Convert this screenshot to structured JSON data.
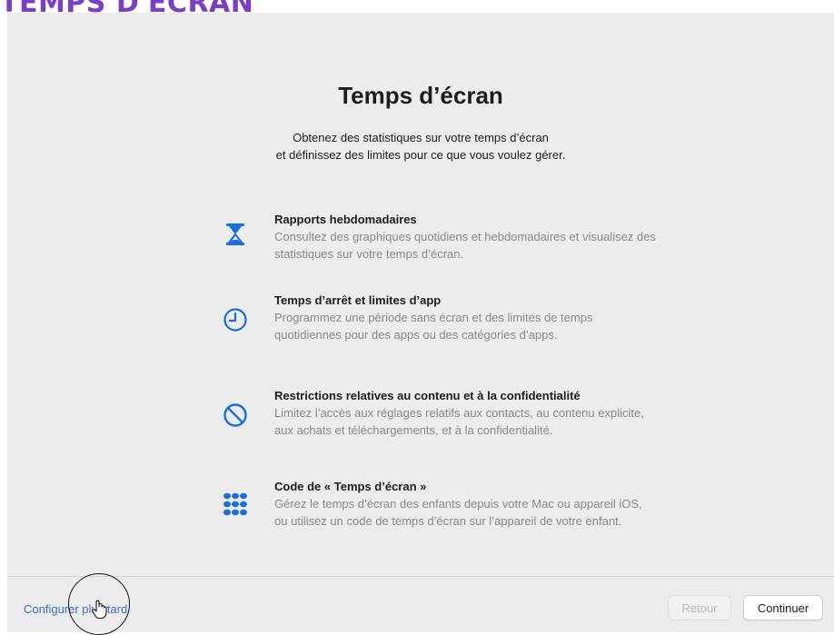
{
  "banner": {
    "text": "TEMPS D'ÉCRAN"
  },
  "window": {
    "title": "Temps d’écran",
    "subtitle_line1": "Obtenez des statistiques sur votre temps d’écran",
    "subtitle_line2": "et définissez des limites pour ce que vous voulez gérer."
  },
  "features": [
    {
      "icon": "hourglass-icon",
      "title": "Rapports hebdomadaires",
      "description": "Consultez des graphiques quotidiens et hebdomadaires et visualisez des statistiques sur votre temps d’écran."
    },
    {
      "icon": "clock-icon",
      "title": "Temps d’arrêt et limites d’app",
      "description": "Programmez une période sans écran et des limites de temps quotidiennes pour des apps ou des catégories d’apps."
    },
    {
      "icon": "restriction-icon",
      "title": "Restrictions relatives au contenu et à la confidentialité",
      "description": "Limitez l’accès aux réglages relatifs aux contacts, au contenu explicite, aux achats et téléchargements, et à la confidentialité."
    },
    {
      "icon": "passcode-keypad-icon",
      "title": "Code de « Temps d’écran »",
      "description": "Gérez le temps d’écran des enfants depuis votre Mac ou appareil iOS, ou utilisez un code de temps d’écran sur l’appareil de votre enfant."
    }
  ],
  "footer": {
    "later_link": "Configurer plus tard",
    "back_button": "Retour",
    "continue_button": "Continuer"
  },
  "colors": {
    "accent_blue": "#1a6fe0",
    "link_blue": "#3b6fd4",
    "banner_purple": "#7a3fc4",
    "window_bg": "#ececec"
  }
}
